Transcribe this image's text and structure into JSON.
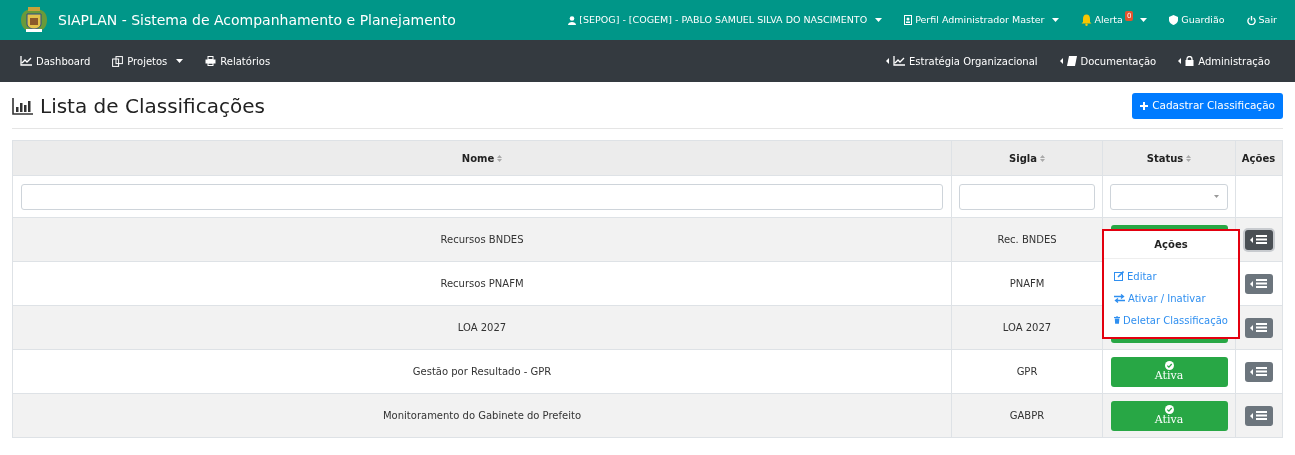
{
  "header": {
    "title": "SIAPLAN - Sistema de Acompanhamento e Planejamento",
    "user": "[SEPOG] - [COGEM] - PABLO SAMUEL SILVA DO NASCIMENTO",
    "profile": "Perfil Administrador Master",
    "alert": "Alerta",
    "alert_count": "0",
    "guardian": "Guardião",
    "logout": "Sair"
  },
  "nav": {
    "left": [
      {
        "label": "Dashboard",
        "dropdown": false
      },
      {
        "label": "Projetos",
        "dropdown": true
      },
      {
        "label": "Relatórios",
        "dropdown": false
      }
    ],
    "right": [
      {
        "label": "Estratégia Organizacional"
      },
      {
        "label": "Documentação"
      },
      {
        "label": "Administração"
      }
    ]
  },
  "page": {
    "title": "Lista de Classificações",
    "add_button": "Cadastrar Classificação"
  },
  "table": {
    "columns": [
      {
        "label": "Nome",
        "sortable": true
      },
      {
        "label": "Sigla",
        "sortable": true
      },
      {
        "label": "Status",
        "sortable": true
      },
      {
        "label": "Ações",
        "sortable": false
      }
    ],
    "rows": [
      {
        "nome": "Recursos BNDES",
        "sigla": "Rec. BNDES",
        "menu_open": true
      },
      {
        "nome": "Recursos PNAFM",
        "sigla": "PNAFM",
        "menu_open": false
      },
      {
        "nome": "LOA 2027",
        "sigla": "LOA 2027",
        "menu_open": false
      },
      {
        "nome": "Gestão por Resultado - GPR",
        "sigla": "GPR",
        "status": "Ativa",
        "menu_open": false
      },
      {
        "nome": "Monitoramento do Gabinete do Prefeito",
        "sigla": "GABPR",
        "status": "Ativa",
        "menu_open": false
      }
    ]
  },
  "actions_menu": {
    "title": "Ações",
    "items": [
      {
        "label": "Editar"
      },
      {
        "label": "Ativar / Inativar"
      },
      {
        "label": "Deletar Classificação"
      }
    ]
  }
}
